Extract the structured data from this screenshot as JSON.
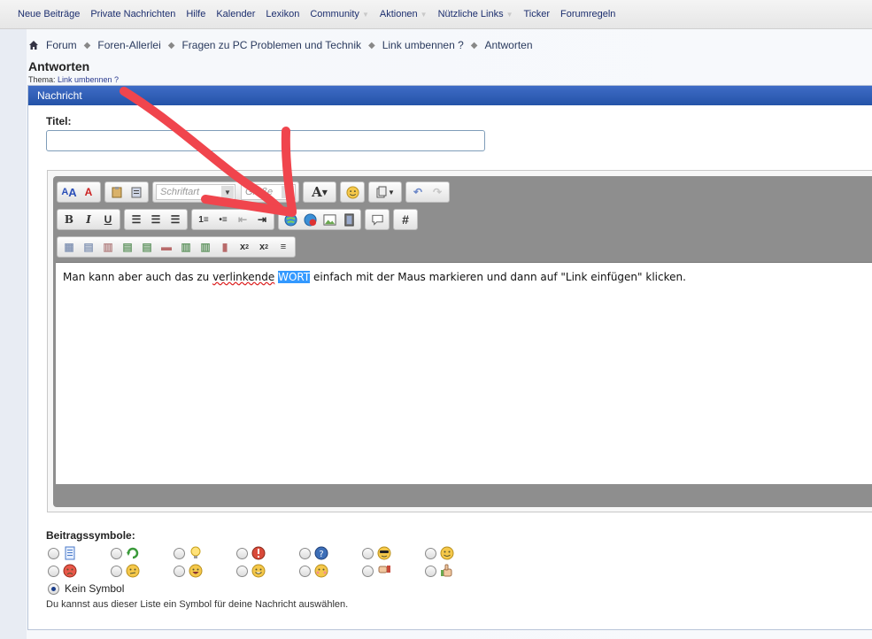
{
  "nav": {
    "items": [
      {
        "label": "Neue Beiträge",
        "has_menu": false
      },
      {
        "label": "Private Nachrichten",
        "has_menu": false
      },
      {
        "label": "Hilfe",
        "has_menu": false
      },
      {
        "label": "Kalender",
        "has_menu": false
      },
      {
        "label": "Lexikon",
        "has_menu": false
      },
      {
        "label": "Community",
        "has_menu": true
      },
      {
        "label": "Aktionen",
        "has_menu": true
      },
      {
        "label": "Nützliche Links",
        "has_menu": true
      },
      {
        "label": "Ticker",
        "has_menu": false
      },
      {
        "label": "Forumregeln",
        "has_menu": false
      }
    ]
  },
  "breadcrumb": [
    "Forum",
    "Foren-Allerlei",
    "Fragen zu PC Problemen und Technik",
    "Link umbennen ?",
    "Antworten"
  ],
  "page": {
    "title": "Antworten",
    "thema_prefix": "Thema: ",
    "thema_link": "Link umbennen ?"
  },
  "panel": {
    "header": "Nachricht",
    "titel_label": "Titel:",
    "titel_value": ""
  },
  "editor": {
    "font_placeholder": "Schriftart",
    "size_placeholder": "Größe",
    "text_before": "Man kann aber auch das zu ",
    "text_misspelled": "verlinkende",
    "text_space": " ",
    "text_selected": "WORT",
    "text_after": " einfach mit der Maus markieren und dann auf \"Link einfügen\" klicken."
  },
  "symbols": {
    "label": "Beitragssymbole:",
    "row1": [
      "document-icon",
      "refresh-icon",
      "lightbulb-icon",
      "exclamation-icon",
      "question-icon",
      "cool-smiley-icon",
      "smiley-icon"
    ],
    "row2": [
      "angry-smiley-icon",
      "confused-smiley-icon",
      "laugh-smiley-icon",
      "grin-smiley-icon",
      "embarrassed-smiley-icon",
      "thumbs-down-icon",
      "thumbs-up-icon"
    ],
    "kein_label": "Kein Symbol",
    "hint": "Du kannst aus dieser Liste ein Symbol für deine Nachricht auswählen."
  },
  "colors": {
    "header_blue": "#2f5fb8",
    "selection": "#3399ff",
    "arrow_red": "#f0454d"
  }
}
